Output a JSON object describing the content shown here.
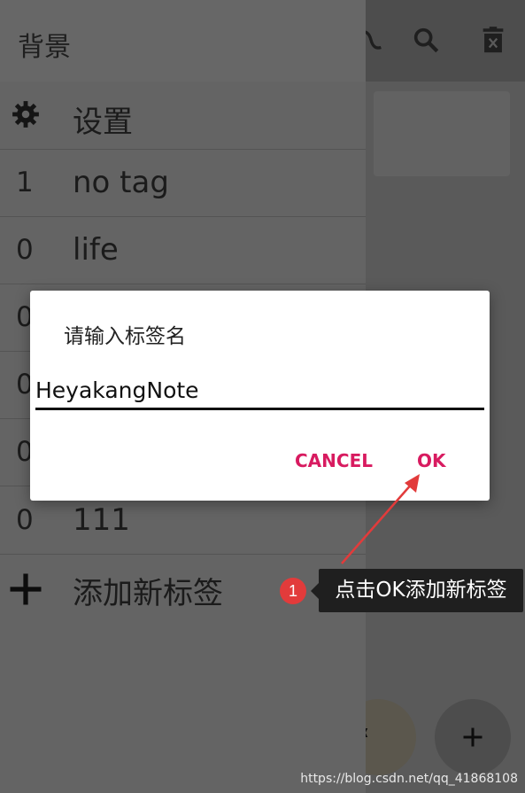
{
  "drawer": {
    "title": "背景",
    "settings_label": "设置",
    "tags": [
      {
        "count": "1",
        "label": "no tag"
      },
      {
        "count": "0",
        "label": "life"
      },
      {
        "count": "0",
        "label": ""
      },
      {
        "count": "0",
        "label": ""
      },
      {
        "count": "0",
        "label": ""
      },
      {
        "count": "0",
        "label": "111"
      }
    ],
    "add_tag_label": "添加新标签"
  },
  "dialog": {
    "title": "请输入标签名",
    "input_value": "HeyakangNote",
    "cancel_label": "CANCEL",
    "ok_label": "OK"
  },
  "annotation": {
    "badge_number": "1",
    "callout_text": "点击OK添加新标签"
  },
  "watermark": "https://blog.csdn.net/qq_41868108",
  "colors": {
    "accent": "#d81b60",
    "badge": "#e23b3b",
    "callout_bg": "#1f1f1f"
  }
}
